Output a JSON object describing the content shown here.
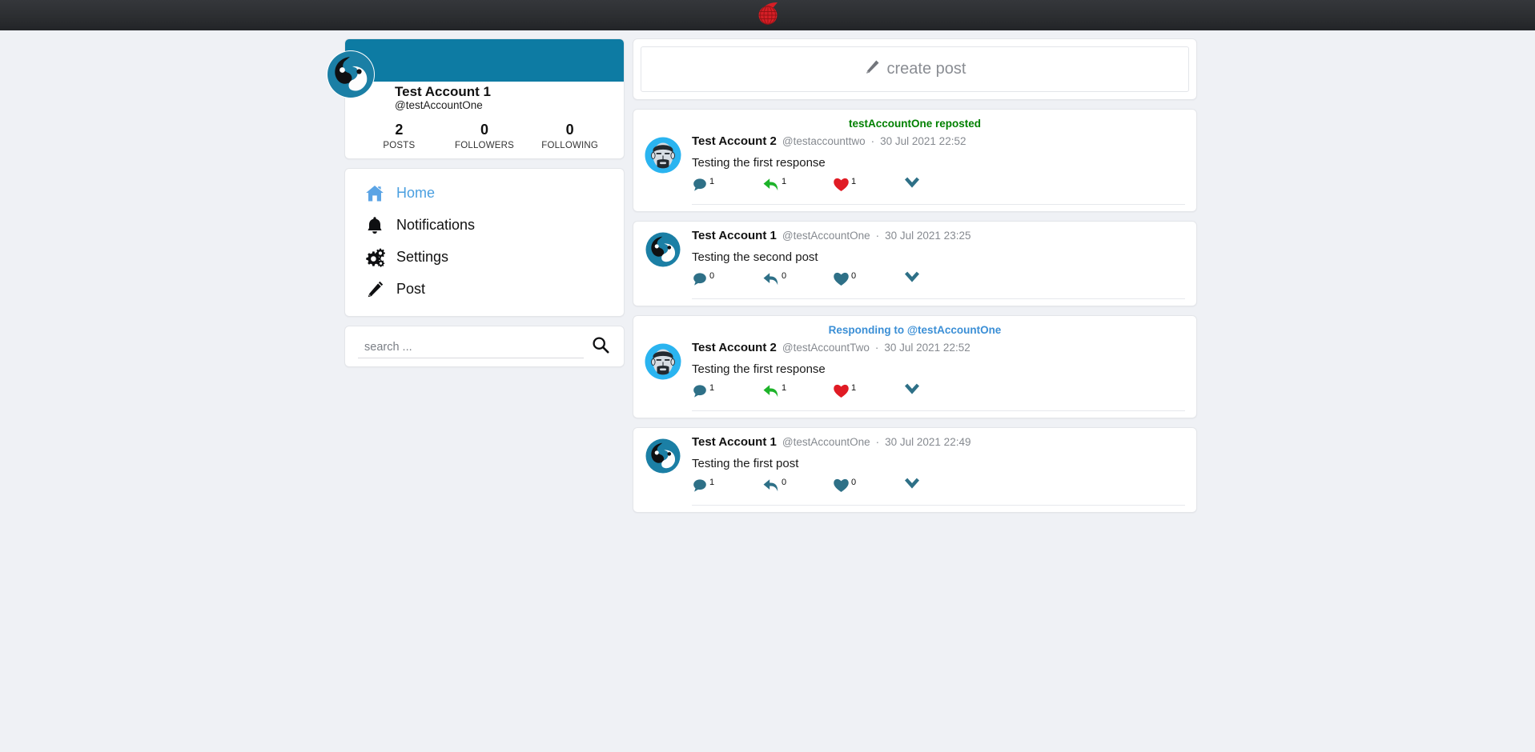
{
  "topbar": {
    "logo_name": "red-globe-logo"
  },
  "colors": {
    "banner_teal": "#0d7ba3",
    "icon_teal": "#2e7087",
    "repost_green": "#1db329",
    "like_red": "#e01b24",
    "link_blue": "#3b8fd6",
    "repost_label_green": "#008000",
    "page_bg": "#eff1f5",
    "header_dark": "#2c2e31"
  },
  "profile": {
    "display_name": "Test Account 1",
    "handle": "@testAccountOne",
    "avatar_name": "test-account-one-avatar",
    "stats": [
      {
        "value": "2",
        "label": "POSTS"
      },
      {
        "value": "0",
        "label": "FOLLOWERS"
      },
      {
        "value": "0",
        "label": "FOLLOWING"
      }
    ]
  },
  "nav": {
    "items": [
      {
        "label": "Home",
        "icon": "home-icon",
        "active": true
      },
      {
        "label": "Notifications",
        "icon": "bell-icon",
        "active": false
      },
      {
        "label": "Settings",
        "icon": "gears-icon",
        "active": false
      },
      {
        "label": "Post",
        "icon": "pencil-icon",
        "active": false
      }
    ]
  },
  "search": {
    "value": "",
    "placeholder": "search ...",
    "icon": "search-icon"
  },
  "compose": {
    "label": "create post",
    "icon": "pencil-icon"
  },
  "feed": {
    "posts": [
      {
        "banner_type": "repost",
        "banner_text": "testAccountOne reposted",
        "author": "Test Account 2",
        "handle": "@testaccounttwo",
        "separator": "·",
        "timestamp": "30 Jul 2021 22:52",
        "text": "Testing the first response",
        "avatar_name": "test-account-two-avatar",
        "actions": {
          "comment_count": "1",
          "comment_active": false,
          "repost_count": "1",
          "repost_active": true,
          "like_count": "1",
          "like_active": true
        }
      },
      {
        "banner_type": "none",
        "banner_text": "",
        "author": "Test Account 1",
        "handle": "@testAccountOne",
        "separator": "·",
        "timestamp": "30 Jul 2021 23:25",
        "text": "Testing the second post",
        "avatar_name": "test-account-one-avatar",
        "actions": {
          "comment_count": "0",
          "comment_active": false,
          "repost_count": "0",
          "repost_active": false,
          "like_count": "0",
          "like_active": false
        }
      },
      {
        "banner_type": "reply",
        "banner_text": "Responding to @testAccountOne",
        "author": "Test Account 2",
        "handle": "@testAccountTwo",
        "separator": "·",
        "timestamp": "30 Jul 2021 22:52",
        "text": "Testing the first response",
        "avatar_name": "test-account-two-avatar",
        "actions": {
          "comment_count": "1",
          "comment_active": false,
          "repost_count": "1",
          "repost_active": true,
          "like_count": "1",
          "like_active": true
        }
      },
      {
        "banner_type": "none",
        "banner_text": "",
        "author": "Test Account 1",
        "handle": "@testAccountOne",
        "separator": "·",
        "timestamp": "30 Jul 2021 22:49",
        "text": "Testing the first post",
        "avatar_name": "test-account-one-avatar",
        "actions": {
          "comment_count": "1",
          "comment_active": false,
          "repost_count": "0",
          "repost_active": false,
          "like_count": "0",
          "like_active": false
        }
      }
    ]
  }
}
